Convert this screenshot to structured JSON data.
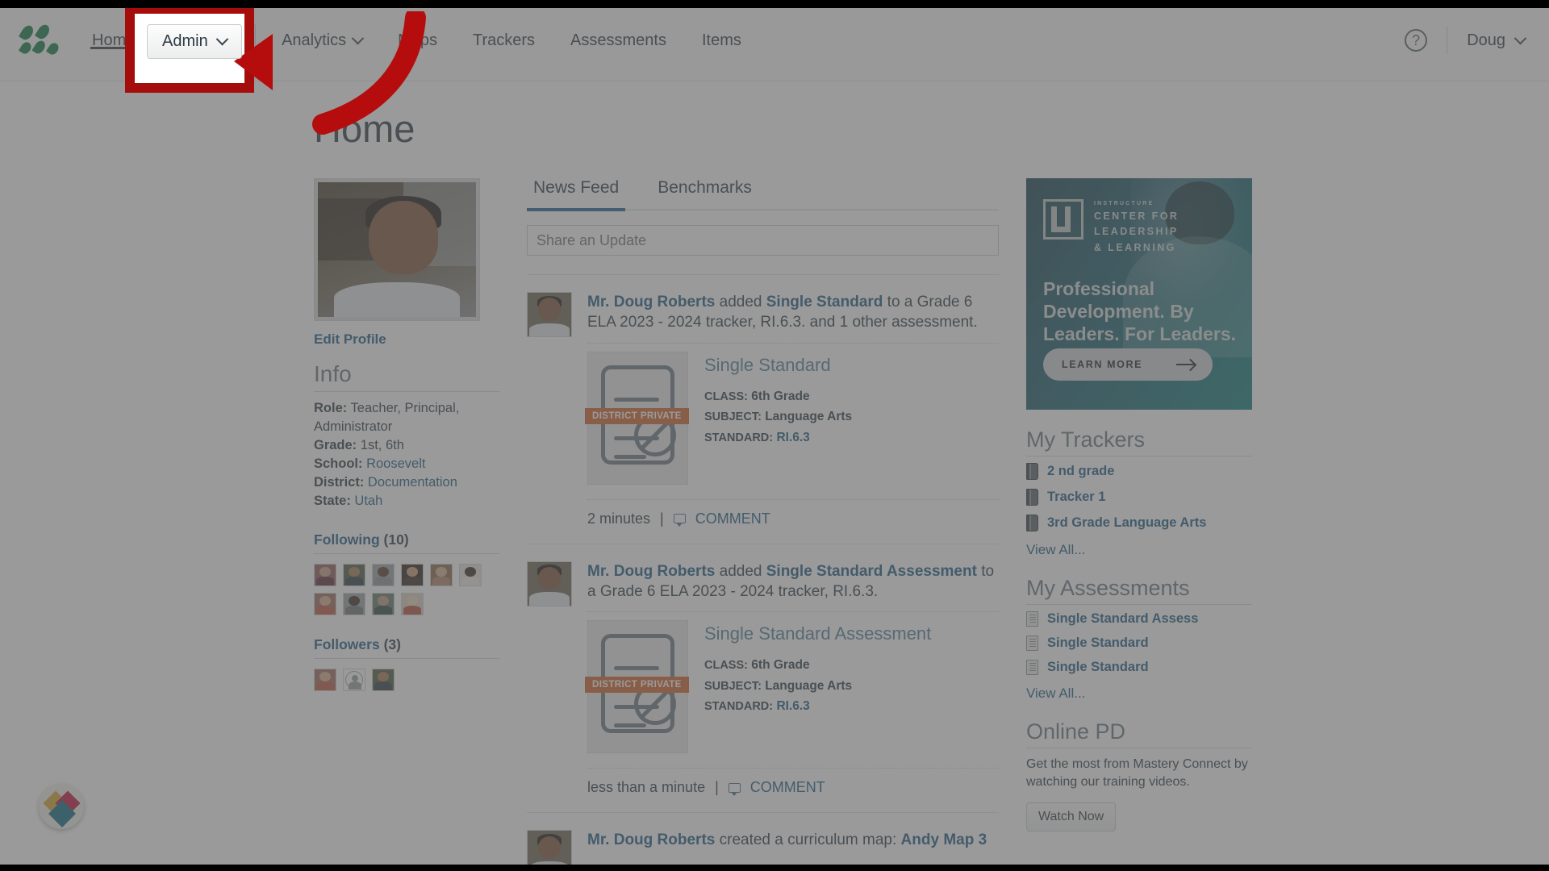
{
  "topnav": {
    "logo_name": "mastery-connect-logo",
    "items": [
      {
        "label": "Home",
        "active": true,
        "has_caret": false
      },
      {
        "label": "Analytics",
        "active": false,
        "has_caret": true
      },
      {
        "label": "Maps",
        "active": false,
        "has_caret": false
      },
      {
        "label": "Trackers",
        "active": false,
        "has_caret": false
      },
      {
        "label": "Assessments",
        "active": false,
        "has_caret": false
      },
      {
        "label": "Items",
        "active": false,
        "has_caret": false
      }
    ],
    "admin_label": "Admin",
    "help_glyph": "?",
    "user_label": "Doug"
  },
  "page": {
    "title": "Home"
  },
  "profile": {
    "edit_label": "Edit Profile",
    "info_heading": "Info",
    "info": [
      {
        "label": "Role:",
        "value": " Teacher, Principal, Administrator",
        "link": false
      },
      {
        "label": "Grade:",
        "value": " 1st, 6th",
        "link": false
      },
      {
        "label": "School:",
        "value": " Roosevelt",
        "link": true
      },
      {
        "label": "District:",
        "value": " Documentation",
        "link": true
      },
      {
        "label": "State:",
        "value": " Utah",
        "link": true
      }
    ],
    "following_label": "Following",
    "following_count": "(10)",
    "followers_label": "Followers",
    "followers_count": "(3)"
  },
  "feed": {
    "tabs": [
      {
        "label": "News Feed",
        "active": true
      },
      {
        "label": "Benchmarks",
        "active": false
      }
    ],
    "share_placeholder": "Share an Update",
    "share_value": "",
    "posts": [
      {
        "author": "Mr. Doug Roberts",
        "action_1": " added ",
        "object": "Single Standard",
        "action_2": " to a Grade 6 ELA 2023 - 2024 tracker, RI.6.3. and 1 other assessment.",
        "asset": {
          "title": "Single Standard",
          "badge": "DISTRICT PRIVATE",
          "class_label": "CLASS:",
          "class_value": " 6th Grade",
          "subject_label": "SUBJECT:",
          "subject_value": " Language Arts",
          "standard_label": "STANDARD:",
          "standard_value": "RI.6.3"
        },
        "time": "2 minutes",
        "divider": "|",
        "comment_label": "COMMENT"
      },
      {
        "author": "Mr. Doug Roberts",
        "action_1": " added ",
        "object": "Single Standard Assessment",
        "action_2": " to a Grade 6 ELA 2023 - 2024 tracker, RI.6.3.",
        "asset": {
          "title": "Single Standard Assessment",
          "badge": "DISTRICT PRIVATE",
          "class_label": "CLASS:",
          "class_value": " 6th Grade",
          "subject_label": "SUBJECT:",
          "subject_value": " Language Arts",
          "standard_label": "STANDARD:",
          "standard_value": "RI.6.3"
        },
        "time": "less than a minute",
        "divider": "|",
        "comment_label": "COMMENT"
      },
      {
        "author": "Mr. Doug Roberts",
        "action_1": " created a curriculum map: ",
        "object": "Andy Map 3",
        "action_2": ""
      }
    ]
  },
  "ad": {
    "brand_tiny": "INSTRUCTURE",
    "brand_line1": "CENTER FOR",
    "brand_line2": "LEADERSHIP",
    "brand_line3": "& LEARNING",
    "headline": "Professional Development. By Leaders. For Leaders.",
    "cta": "LEARN MORE"
  },
  "trackers": {
    "heading": "My Trackers",
    "items": [
      {
        "label": "2 nd grade"
      },
      {
        "label": "Tracker 1"
      },
      {
        "label": "3rd Grade Language Arts"
      }
    ],
    "view_all": "View All..."
  },
  "assessments": {
    "heading": "My Assessments",
    "items": [
      {
        "label": "Single Standard Assess"
      },
      {
        "label": "Single Standard"
      },
      {
        "label": "Single Standard"
      }
    ],
    "view_all": "View All..."
  },
  "online_pd": {
    "heading": "Online PD",
    "body": "Get the most from Mastery Connect by watching our training videos.",
    "button": "Watch Now"
  },
  "annotation": {
    "highlight_target": "Admin",
    "highlight_color": "#a50c0c",
    "arrow_color": "#b50d0d"
  },
  "colors": {
    "link": "#1c5b84",
    "accent_tab": "#1c6291",
    "badge_orange": "#d2622a",
    "logo_green": "#0b7a42"
  }
}
